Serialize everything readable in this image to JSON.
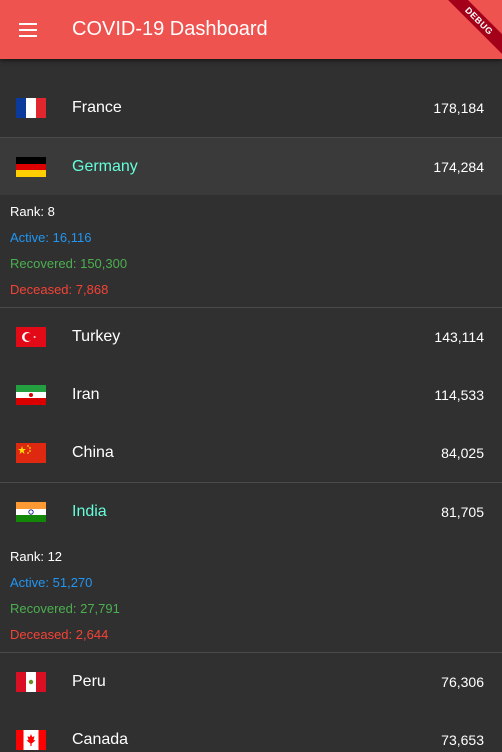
{
  "app": {
    "title": "COVID-19 Dashboard",
    "debug_label": "DEBUG"
  },
  "countries": [
    {
      "name": "France",
      "count": "178,184",
      "flag": "france-flag"
    },
    {
      "name": "Germany",
      "count": "174,284",
      "flag": "germany-flag",
      "expanded": true,
      "rank": "Rank: 8",
      "active": "Active: 16,116",
      "recovered": "Recovered: 150,300",
      "deceased": "Deceased: 7,868"
    },
    {
      "name": "Turkey",
      "count": "143,114",
      "flag": "turkey-flag"
    },
    {
      "name": "Iran",
      "count": "114,533",
      "flag": "iran-flag"
    },
    {
      "name": "China",
      "count": "84,025",
      "flag": "china-flag"
    },
    {
      "name": "India",
      "count": "81,705",
      "flag": "india-flag",
      "expanded": true,
      "rank": "Rank: 12",
      "active": "Active: 51,270",
      "recovered": "Recovered: 27,791",
      "deceased": "Deceased: 2,644"
    },
    {
      "name": "Peru",
      "count": "76,306",
      "flag": "peru-flag"
    },
    {
      "name": "Canada",
      "count": "73,653",
      "flag": "canada-flag"
    }
  ],
  "colors": {
    "appbar": "#ef5350",
    "expanded_name": "#64ffda",
    "active": "#2196f3",
    "recovered": "#4caf50",
    "deceased": "#f44336"
  }
}
